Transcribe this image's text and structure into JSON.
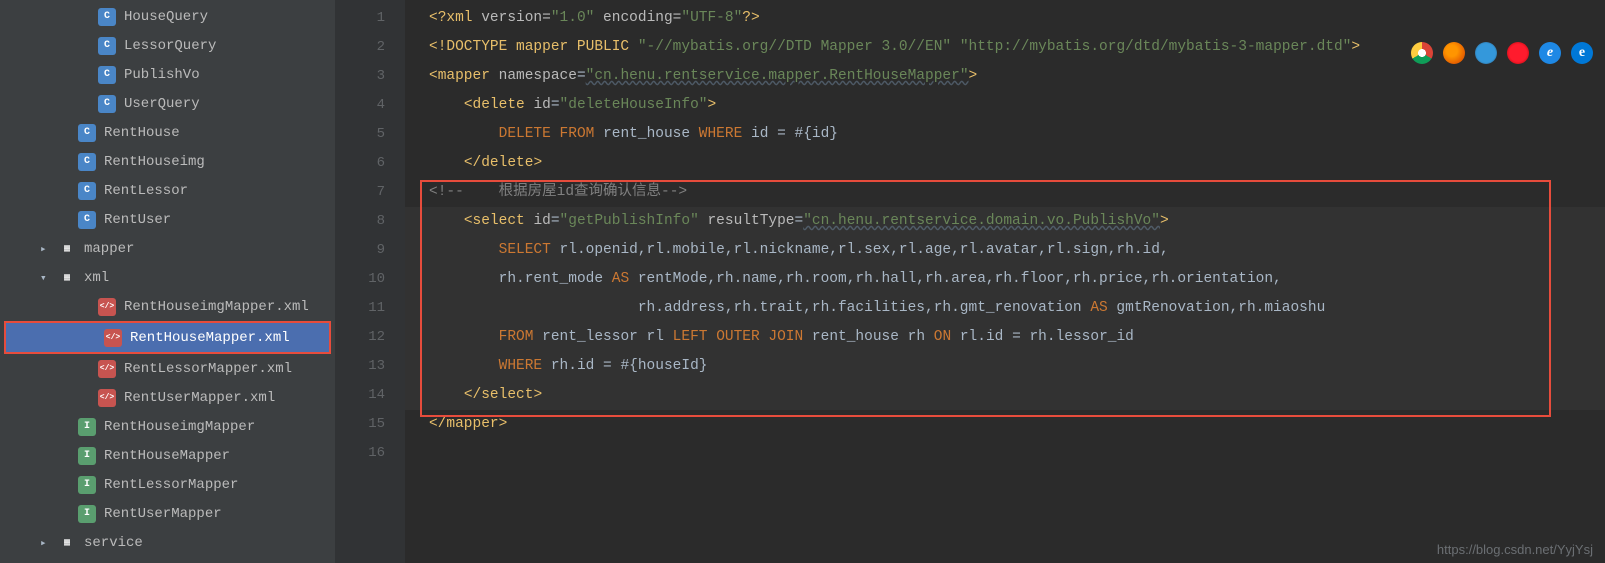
{
  "sidebar": {
    "items": [
      {
        "icon": "class",
        "label": "HouseQuery",
        "indent": 4,
        "truncated": true
      },
      {
        "icon": "class",
        "label": "LessorQuery",
        "indent": 4
      },
      {
        "icon": "class",
        "label": "PublishVo",
        "indent": 4
      },
      {
        "icon": "class",
        "label": "UserQuery",
        "indent": 4
      },
      {
        "icon": "class",
        "label": "RentHouse",
        "indent": 3
      },
      {
        "icon": "class",
        "label": "RentHouseimg",
        "indent": 3
      },
      {
        "icon": "class",
        "label": "RentLessor",
        "indent": 3
      },
      {
        "icon": "class",
        "label": "RentUser",
        "indent": 3
      },
      {
        "icon": "folder",
        "label": "mapper",
        "indent": 2,
        "arrow": "▸"
      },
      {
        "icon": "folder",
        "label": "xml",
        "indent": 2,
        "arrow": "▾"
      },
      {
        "icon": "xml",
        "label": "RentHouseimgMapper.xml",
        "indent": 4
      },
      {
        "icon": "xml",
        "label": "RentHouseMapper.xml",
        "indent": 4,
        "selected": true,
        "boxed": true
      },
      {
        "icon": "xml",
        "label": "RentLessorMapper.xml",
        "indent": 4
      },
      {
        "icon": "xml",
        "label": "RentUserMapper.xml",
        "indent": 4
      },
      {
        "icon": "interface",
        "label": "RentHouseimgMapper",
        "indent": 3
      },
      {
        "icon": "interface",
        "label": "RentHouseMapper",
        "indent": 3
      },
      {
        "icon": "interface",
        "label": "RentLessorMapper",
        "indent": 3
      },
      {
        "icon": "interface",
        "label": "RentUserMapper",
        "indent": 3
      },
      {
        "icon": "folder",
        "label": "service",
        "indent": 2,
        "arrow": "▸"
      }
    ]
  },
  "editor": {
    "line_numbers": [
      "1",
      "2",
      "3",
      "4",
      "5",
      "6",
      "7",
      "8",
      "9",
      "10",
      "11",
      "12",
      "13",
      "14",
      "15",
      "16"
    ],
    "lines": {
      "l1": {
        "pre": "<?",
        "tag": "xml",
        "attrs": " version=",
        "v1": "\"1.0\"",
        "attrs2": " encoding=",
        "v2": "\"UTF-8\"",
        "post": "?>"
      },
      "l2": {
        "pre": "<!",
        "tag": "DOCTYPE mapper PUBLIC ",
        "s1": "\"-//mybatis.org//DTD Mapper 3.0//EN\"",
        "sp": " ",
        "s2": "\"http://mybatis.org/dtd/mybatis-3-mapper.dtd\"",
        "post": ">"
      },
      "l3": {
        "open": "<",
        "tag": "mapper",
        "sp": " ",
        "attr": "namespace",
        "eq": "=",
        "val": "\"cn.henu.rentservice.mapper.RentHouseMapper\"",
        "close": ">"
      },
      "l4": {
        "indent": "    ",
        "open": "<",
        "tag": "delete",
        "sp": " ",
        "attr": "id",
        "eq": "=",
        "val": "\"deleteHouseInfo\"",
        "close": ">"
      },
      "l5": {
        "indent": "        ",
        "kw1": "DELETE",
        "sp1": " ",
        "kw2": "FROM",
        "sp2": " ",
        "t1": "rent_house ",
        "kw3": "WHERE",
        "t2": " id = #{id}"
      },
      "l6": {
        "indent": "    ",
        "open": "</",
        "tag": "delete",
        "close": ">"
      },
      "l7": {
        "open": "<!--",
        "txt": "    根据房屋id查询确认信息",
        "close": "-->"
      },
      "l8": {
        "indent": "    ",
        "open": "<",
        "tag": "select",
        "sp": " ",
        "a1": "id",
        "eq1": "=",
        "v1": "\"getPublishInfo\"",
        "sp2": " ",
        "a2": "resultType",
        "eq2": "=",
        "v2": "\"cn.henu.rentservice.domain.vo.PublishVo\"",
        "close": ">"
      },
      "l9": {
        "indent": "        ",
        "kw": "SELECT",
        "txt": " rl.openid,rl.mobile,rl.nickname,rl.sex,rl.age,rl.avatar,rl.sign,rh.id,"
      },
      "l10": {
        "indent": "        ",
        "t1": "rh.rent_mode ",
        "kw": "AS",
        "t2": " rentMode,rh.name,rh.room,rh.hall,rh.area,rh.floor,rh.price,rh.orientation,"
      },
      "l11": {
        "indent": "                        ",
        "t1": "rh.address,rh.trait,rh.facilities,rh.gmt_renovation ",
        "kw": "AS",
        "t2": " gmtRenovation,rh.miaoshu"
      },
      "l12": {
        "indent": "        ",
        "kw1": "FROM",
        "t1": " rent_lessor rl ",
        "kw2": "LEFT",
        "sp1": " ",
        "kw3": "OUTER",
        "sp2": " ",
        "kw4": "JOIN",
        "t2": " rent_house rh ",
        "kw5": "ON",
        "t3": " rl.id = rh.lessor_id"
      },
      "l13": {
        "indent": "        ",
        "kw": "WHERE",
        "txt": " rh.id = #{houseId}"
      },
      "l14": {
        "indent": "    ",
        "open": "</",
        "tag": "select",
        "close": ">"
      },
      "l15": {
        "open": "</",
        "tag": "mapper",
        "close": ">"
      }
    }
  },
  "watermark": "https://blog.csdn.net/YyjYsj",
  "browser_colors": [
    "#e34c26",
    "#e67e22",
    "#3498db",
    "#c0392b",
    "#2980b9",
    "#5dade2"
  ]
}
